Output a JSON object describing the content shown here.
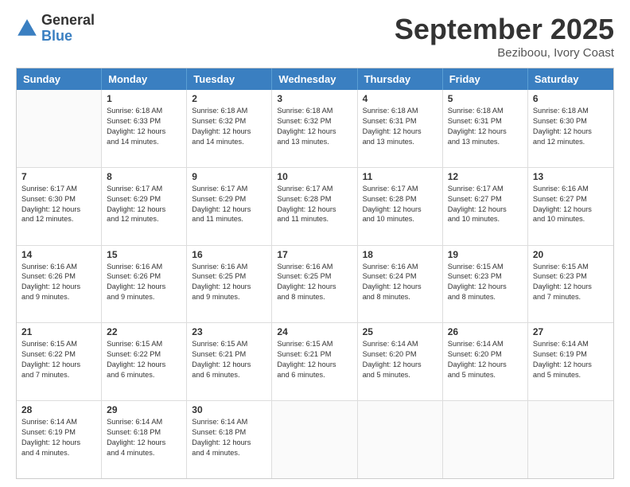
{
  "logo": {
    "general": "General",
    "blue": "Blue"
  },
  "header": {
    "month": "September 2025",
    "location": "Beziboou, Ivory Coast"
  },
  "days": [
    "Sunday",
    "Monday",
    "Tuesday",
    "Wednesday",
    "Thursday",
    "Friday",
    "Saturday"
  ],
  "weeks": [
    [
      {
        "day": "",
        "content": ""
      },
      {
        "day": "1",
        "content": "Sunrise: 6:18 AM\nSunset: 6:33 PM\nDaylight: 12 hours\nand 14 minutes."
      },
      {
        "day": "2",
        "content": "Sunrise: 6:18 AM\nSunset: 6:32 PM\nDaylight: 12 hours\nand 14 minutes."
      },
      {
        "day": "3",
        "content": "Sunrise: 6:18 AM\nSunset: 6:32 PM\nDaylight: 12 hours\nand 13 minutes."
      },
      {
        "day": "4",
        "content": "Sunrise: 6:18 AM\nSunset: 6:31 PM\nDaylight: 12 hours\nand 13 minutes."
      },
      {
        "day": "5",
        "content": "Sunrise: 6:18 AM\nSunset: 6:31 PM\nDaylight: 12 hours\nand 13 minutes."
      },
      {
        "day": "6",
        "content": "Sunrise: 6:18 AM\nSunset: 6:30 PM\nDaylight: 12 hours\nand 12 minutes."
      }
    ],
    [
      {
        "day": "7",
        "content": "Sunrise: 6:17 AM\nSunset: 6:30 PM\nDaylight: 12 hours\nand 12 minutes."
      },
      {
        "day": "8",
        "content": "Sunrise: 6:17 AM\nSunset: 6:29 PM\nDaylight: 12 hours\nand 12 minutes."
      },
      {
        "day": "9",
        "content": "Sunrise: 6:17 AM\nSunset: 6:29 PM\nDaylight: 12 hours\nand 11 minutes."
      },
      {
        "day": "10",
        "content": "Sunrise: 6:17 AM\nSunset: 6:28 PM\nDaylight: 12 hours\nand 11 minutes."
      },
      {
        "day": "11",
        "content": "Sunrise: 6:17 AM\nSunset: 6:28 PM\nDaylight: 12 hours\nand 10 minutes."
      },
      {
        "day": "12",
        "content": "Sunrise: 6:17 AM\nSunset: 6:27 PM\nDaylight: 12 hours\nand 10 minutes."
      },
      {
        "day": "13",
        "content": "Sunrise: 6:16 AM\nSunset: 6:27 PM\nDaylight: 12 hours\nand 10 minutes."
      }
    ],
    [
      {
        "day": "14",
        "content": "Sunrise: 6:16 AM\nSunset: 6:26 PM\nDaylight: 12 hours\nand 9 minutes."
      },
      {
        "day": "15",
        "content": "Sunrise: 6:16 AM\nSunset: 6:26 PM\nDaylight: 12 hours\nand 9 minutes."
      },
      {
        "day": "16",
        "content": "Sunrise: 6:16 AM\nSunset: 6:25 PM\nDaylight: 12 hours\nand 9 minutes."
      },
      {
        "day": "17",
        "content": "Sunrise: 6:16 AM\nSunset: 6:25 PM\nDaylight: 12 hours\nand 8 minutes."
      },
      {
        "day": "18",
        "content": "Sunrise: 6:16 AM\nSunset: 6:24 PM\nDaylight: 12 hours\nand 8 minutes."
      },
      {
        "day": "19",
        "content": "Sunrise: 6:15 AM\nSunset: 6:23 PM\nDaylight: 12 hours\nand 8 minutes."
      },
      {
        "day": "20",
        "content": "Sunrise: 6:15 AM\nSunset: 6:23 PM\nDaylight: 12 hours\nand 7 minutes."
      }
    ],
    [
      {
        "day": "21",
        "content": "Sunrise: 6:15 AM\nSunset: 6:22 PM\nDaylight: 12 hours\nand 7 minutes."
      },
      {
        "day": "22",
        "content": "Sunrise: 6:15 AM\nSunset: 6:22 PM\nDaylight: 12 hours\nand 6 minutes."
      },
      {
        "day": "23",
        "content": "Sunrise: 6:15 AM\nSunset: 6:21 PM\nDaylight: 12 hours\nand 6 minutes."
      },
      {
        "day": "24",
        "content": "Sunrise: 6:15 AM\nSunset: 6:21 PM\nDaylight: 12 hours\nand 6 minutes."
      },
      {
        "day": "25",
        "content": "Sunrise: 6:14 AM\nSunset: 6:20 PM\nDaylight: 12 hours\nand 5 minutes."
      },
      {
        "day": "26",
        "content": "Sunrise: 6:14 AM\nSunset: 6:20 PM\nDaylight: 12 hours\nand 5 minutes."
      },
      {
        "day": "27",
        "content": "Sunrise: 6:14 AM\nSunset: 6:19 PM\nDaylight: 12 hours\nand 5 minutes."
      }
    ],
    [
      {
        "day": "28",
        "content": "Sunrise: 6:14 AM\nSunset: 6:19 PM\nDaylight: 12 hours\nand 4 minutes."
      },
      {
        "day": "29",
        "content": "Sunrise: 6:14 AM\nSunset: 6:18 PM\nDaylight: 12 hours\nand 4 minutes."
      },
      {
        "day": "30",
        "content": "Sunrise: 6:14 AM\nSunset: 6:18 PM\nDaylight: 12 hours\nand 4 minutes."
      },
      {
        "day": "",
        "content": ""
      },
      {
        "day": "",
        "content": ""
      },
      {
        "day": "",
        "content": ""
      },
      {
        "day": "",
        "content": ""
      }
    ]
  ]
}
